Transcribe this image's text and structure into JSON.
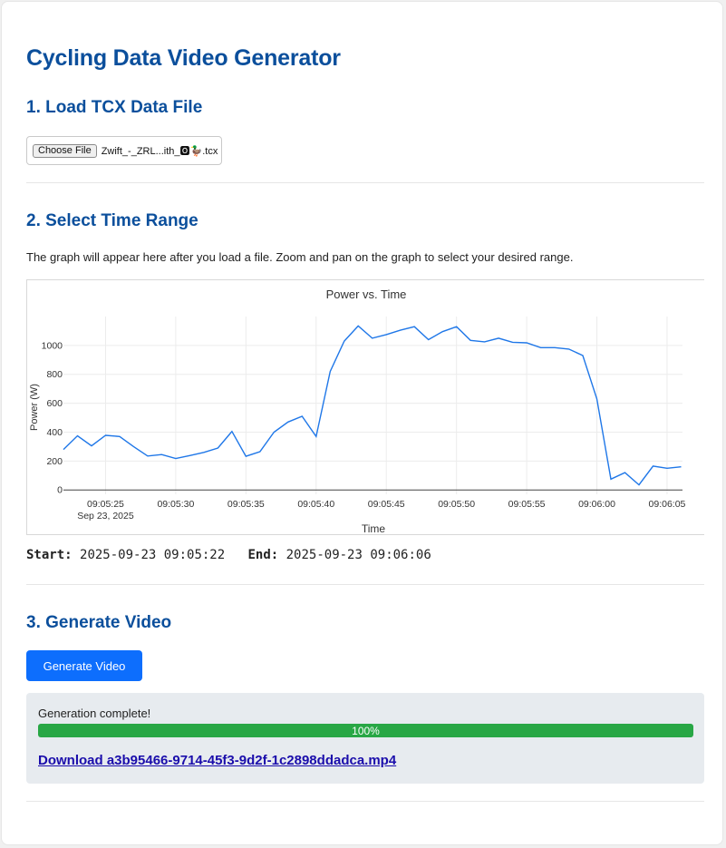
{
  "page": {
    "title": "Cycling Data Video Generator"
  },
  "step1": {
    "heading": "1. Load TCX Data File",
    "choose_file_label": "Choose File",
    "file_name": "Zwift_-_ZRL...ith_🅾🦆.tcx"
  },
  "step2": {
    "heading": "2. Select Time Range",
    "description": "The graph will appear here after you load a file. Zoom and pan on the graph to select your desired range.",
    "start_label": "Start:",
    "start_value": "2025-09-23 09:05:22",
    "end_label": "End:",
    "end_value": "2025-09-23 09:06:06"
  },
  "chart_data": {
    "type": "line",
    "title": "Power vs. Time",
    "xlabel": "Time",
    "ylabel": "Power (W)",
    "x_tick_labels": [
      "09:05:25",
      "09:05:30",
      "09:05:35",
      "09:05:40",
      "09:05:45",
      "09:05:50",
      "09:05:55",
      "09:06:00",
      "09:06:05"
    ],
    "x_tick_sublabel": "Sep 23, 2025",
    "x_tick_seconds": [
      25,
      30,
      35,
      40,
      45,
      50,
      55,
      60,
      65
    ],
    "y_ticks": [
      0,
      200,
      400,
      600,
      800,
      1000
    ],
    "xlim": [
      22,
      66.1
    ],
    "ylim": [
      -30,
      1200
    ],
    "grid": true,
    "line_color": "#1f77e8",
    "series": [
      {
        "x": [
          22,
          23,
          24,
          25,
          26,
          27,
          28,
          29,
          30,
          31,
          32,
          33,
          34,
          35,
          36,
          37,
          38,
          39,
          40,
          41,
          42,
          43,
          44,
          45,
          46,
          47,
          48,
          49,
          50,
          51,
          52,
          53,
          54,
          55,
          56,
          57,
          58,
          59,
          60,
          61,
          62,
          63,
          64,
          65,
          66
        ],
        "values": [
          280,
          375,
          305,
          378,
          370,
          300,
          235,
          245,
          218,
          238,
          260,
          290,
          405,
          233,
          265,
          400,
          470,
          510,
          370,
          820,
          1030,
          1135,
          1050,
          1075,
          1105,
          1130,
          1040,
          1095,
          1130,
          1035,
          1025,
          1050,
          1022,
          1018,
          985,
          985,
          975,
          930,
          630,
          75,
          120,
          35,
          165,
          150,
          160
        ]
      }
    ]
  },
  "step3": {
    "heading": "3. Generate Video",
    "generate_label": "Generate Video",
    "status": "Generation complete!",
    "progress_label": "100%",
    "progress_fraction": 1.0,
    "download_link": "Download a3b95466-9714-45f3-9d2f-1c2898ddadca.mp4"
  }
}
